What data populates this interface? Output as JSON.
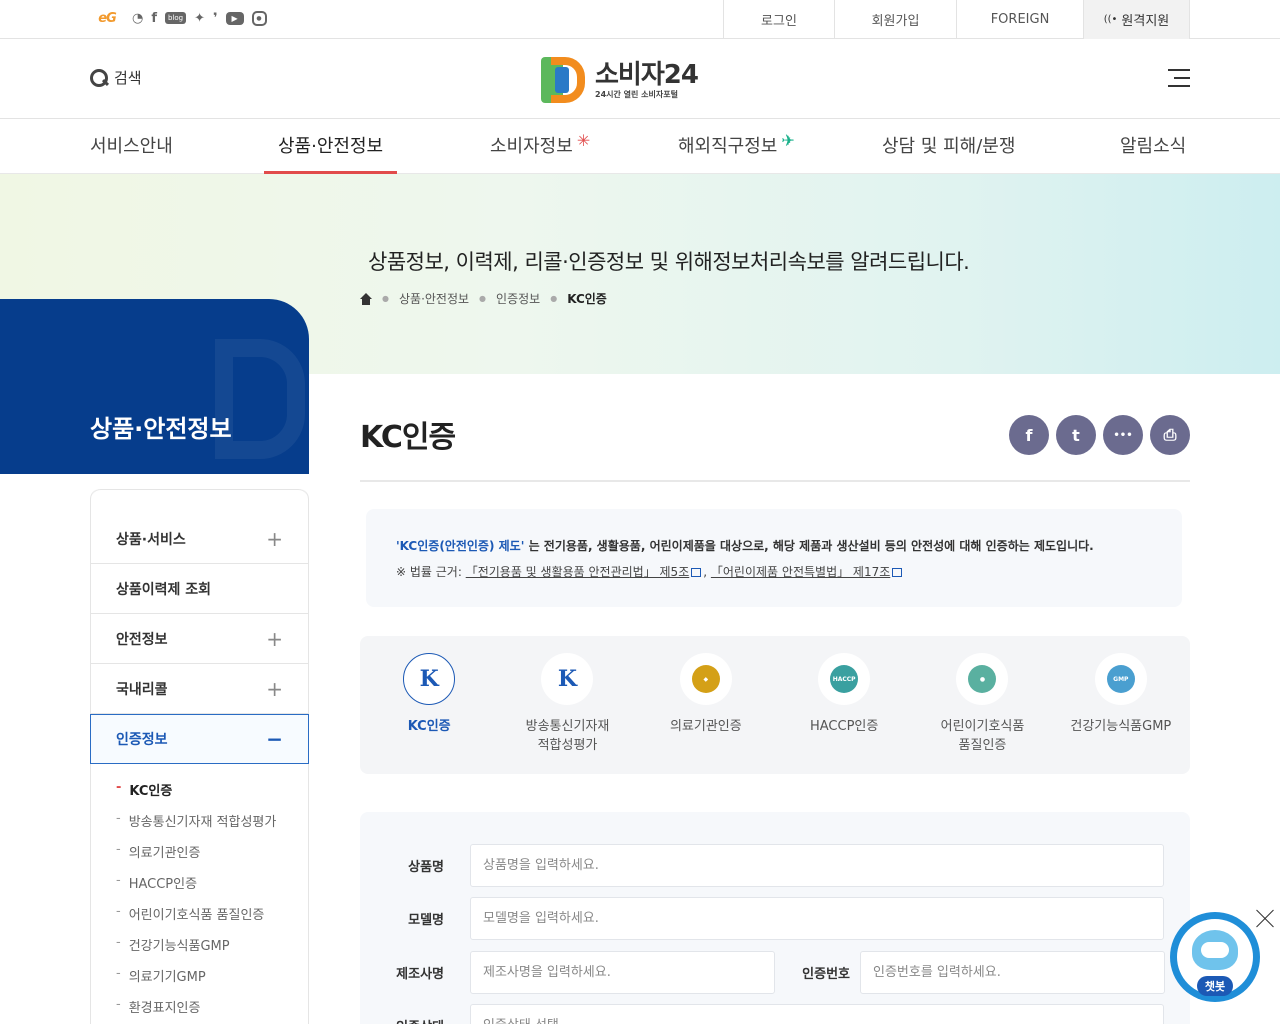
{
  "topbar": {
    "social": [
      "eG",
      "rss-icon",
      "facebook-icon",
      "blog-icon",
      "twitter-icon",
      "pin-icon",
      "youtube-icon",
      "instagram-icon"
    ],
    "eg_label": "eG",
    "blog_label": "blog",
    "login": "로그인",
    "join": "회원가입",
    "foreign": "FOREIGN",
    "remote": "원격지원"
  },
  "header": {
    "search_label": "검색",
    "logo_title": "소비자24",
    "logo_sub": "24시간 열린 소비자포털"
  },
  "gnb": [
    "서비스안내",
    "상품·안전정보",
    "소비자정보",
    "해외직구정보",
    "상담 및 피해/분쟁",
    "알림소식"
  ],
  "banner": {
    "headline": "상품정보, 이력제, 리콜·인증정보 및 위해정보처리속보를 알려드립니다.",
    "breadcrumb": [
      "상품·안전정보",
      "인증정보",
      "KC인증"
    ]
  },
  "sidebar": {
    "title": "상품·안전정보",
    "items": [
      {
        "label": "상품·서비스",
        "toggle": "+"
      },
      {
        "label": "상품이력제 조회",
        "toggle": ""
      },
      {
        "label": "안전정보",
        "toggle": "+"
      },
      {
        "label": "국내리콜",
        "toggle": "+"
      },
      {
        "label": "인증정보",
        "toggle": "−"
      }
    ],
    "sub_items": [
      "KC인증",
      "방송통신기자재 적합성평가",
      "의료기관인증",
      "HACCP인증",
      "어린이기호식품 품질인증",
      "건강기능식품GMP",
      "의료기기GMP",
      "환경표지인증"
    ]
  },
  "content": {
    "title": "KC인증",
    "share_icons": [
      "f",
      "t",
      "•••",
      "⎙"
    ],
    "notice": {
      "highlight": "'KC인증(안전인증) 제도'",
      "line1_rest": " 는 전기용품, 생활용품, 어린이제품을 대상으로, 해당 제품과 생산설비 등의 안전성에 대해 인증하는 제도입니다.",
      "line2_prefix": "※ 법률 근거: ",
      "law1": "「전기용품 및 생활용품 안전관리법」 제5조",
      "law2": "「어린이제품 안전특별법」 제17조"
    },
    "certs": [
      {
        "label": "KC인증",
        "label2": "",
        "icon": "K",
        "color": "#1c59b5"
      },
      {
        "label": "방송통신기자재",
        "label2": "적합성평가",
        "icon": "K",
        "color": "#1c59b5"
      },
      {
        "label": "의료기관인증",
        "label2": "",
        "icon": "",
        "color": "#d4a017"
      },
      {
        "label": "HACCP인증",
        "label2": "",
        "icon": "HACCP",
        "color": "#3aa0a0"
      },
      {
        "label": "어린이기호식품",
        "label2": "품질인증",
        "icon": "",
        "color": "#5ab0a0"
      },
      {
        "label": "건강기능식품GMP",
        "label2": "",
        "icon": "GMP",
        "color": "#4a9fd0"
      }
    ],
    "form": {
      "product_label": "상품명",
      "product_ph": "상품명을 입력하세요.",
      "model_label": "모델명",
      "model_ph": "모델명을 입력하세요.",
      "maker_label": "제조사명",
      "maker_ph": "제조사명을 입력하세요.",
      "certno_label": "인증번호",
      "certno_ph": "인증번호를 입력하세요.",
      "status_label": "인증상태",
      "status_ph": "인증상태 선택"
    }
  },
  "chatbot": {
    "label": "챗봇"
  }
}
